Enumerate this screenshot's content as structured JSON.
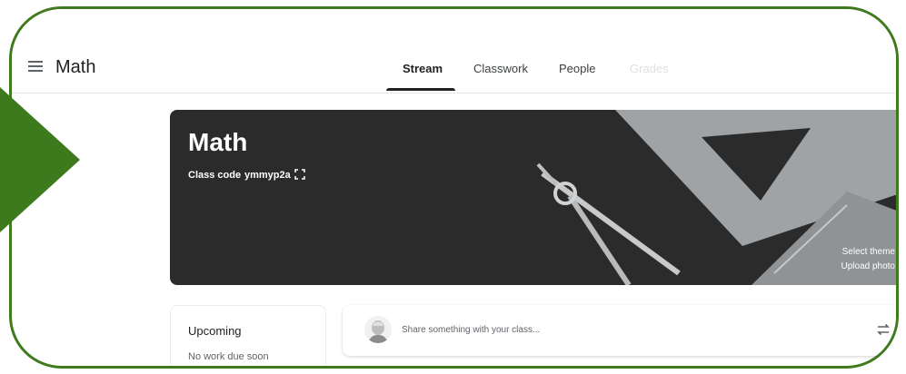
{
  "header": {
    "menu_icon": "hamburger-menu-icon",
    "class_name": "Math",
    "tabs": [
      {
        "label": "Stream",
        "active": true
      },
      {
        "label": "Classwork",
        "active": false
      },
      {
        "label": "People",
        "active": false
      }
    ],
    "faded_tab": "Grades"
  },
  "banner": {
    "title": "Math",
    "class_code_label": "Class code",
    "class_code": "ymmyp2a",
    "expand_icon": "fullscreen-icon",
    "select_theme": "Select theme",
    "upload_photo": "Upload photo"
  },
  "upcoming": {
    "title": "Upcoming",
    "empty_text": "No work due soon"
  },
  "stream": {
    "share_placeholder": "Share something with your class...",
    "repost_icon": "repost-icon"
  },
  "colors": {
    "frame_green": "#3f7a1e",
    "arrow_green": "#3d7a1e",
    "banner_bg": "#2b2b2b"
  }
}
